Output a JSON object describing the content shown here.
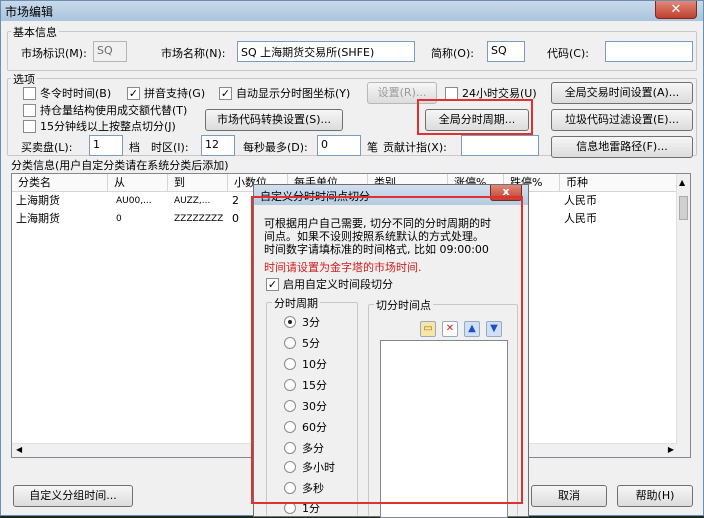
{
  "window": {
    "title": "市场编辑",
    "close": "✕"
  },
  "basic": {
    "legend": "基本信息",
    "market_id_label": "市场标识(M):",
    "market_id_value": "SQ",
    "market_name_label": "市场名称(N):",
    "market_name_value": "SQ 上海期货交易所(SHFE)",
    "short_label": "简称(O):",
    "short_value": "SQ",
    "code_label": "代码(C):",
    "code_value": ""
  },
  "options": {
    "legend": "选项",
    "dst": "冬令时时间(B)",
    "pinyin": "拼音支持(G)",
    "auto_axis": "自动显示分时图坐标(Y)",
    "settings_btn": "设置(R)...",
    "h24": "24小时交易(U)",
    "global_time_btn": "全局交易时间设置(A)...",
    "position_struct": "持仓量结构使用成交额代替(T)",
    "code_convert_btn": "市场代码转换设置(S)...",
    "global_period_btn": "全局分时周期...",
    "junk_filter_btn": "垃圾代码过滤设置(E)...",
    "k15": "15分钟线以上按整点切分(J)",
    "buy_sell_label": "买卖盘(L):",
    "buy_sell_value": "1",
    "dang": "档",
    "tz_label": "时区(I):",
    "tz_value": "12",
    "max_label": "每秒最多(D):",
    "max_value": "0",
    "bi": "笔",
    "contrib_label": "贡献计指(X):",
    "contrib_value": "",
    "mine_path_btn": "信息地雷路径(F)..."
  },
  "classify": {
    "legend": "分类信息(用户自定分类请在系统分类后添加)",
    "columns": [
      "分类名",
      "从",
      "到",
      "小数位",
      "每手单位",
      "类别",
      "涨停%",
      "跌停%",
      "币种"
    ],
    "rows": [
      [
        "上海期货",
        "AU00,...",
        "AUZZ,...",
        "2",
        "",
        "",
        "",
        "",
        "人民币"
      ],
      [
        "上海期货",
        "0",
        "ZZZZZZZZ",
        "0",
        "",
        "",
        "",
        "",
        "人民币"
      ]
    ]
  },
  "bottom": {
    "custom_btn": "自定义分组时间...",
    "cancel_btn": "取消",
    "help_btn": "帮助(H)"
  },
  "dialog": {
    "title": "自定义分时时间点切分",
    "close": "x",
    "desc_1": "可根据用户自己需要, 切分不同的分时周期的时",
    "desc_2": "间点。如果不设则按照系统默认的方式处理。",
    "desc_3": "时间数字请填标准的时间格式, 比如 09:00:00",
    "warn": "时间请设置为金字塔的市场时间.",
    "enable": "启用自定义时间段切分",
    "period_legend": "分时周期",
    "points_legend": "切分时间点",
    "periods": [
      "3分",
      "5分",
      "10分",
      "15分",
      "30分",
      "60分",
      "多分",
      "多小时",
      "多秒",
      "1分"
    ],
    "selected_period": "3分"
  }
}
